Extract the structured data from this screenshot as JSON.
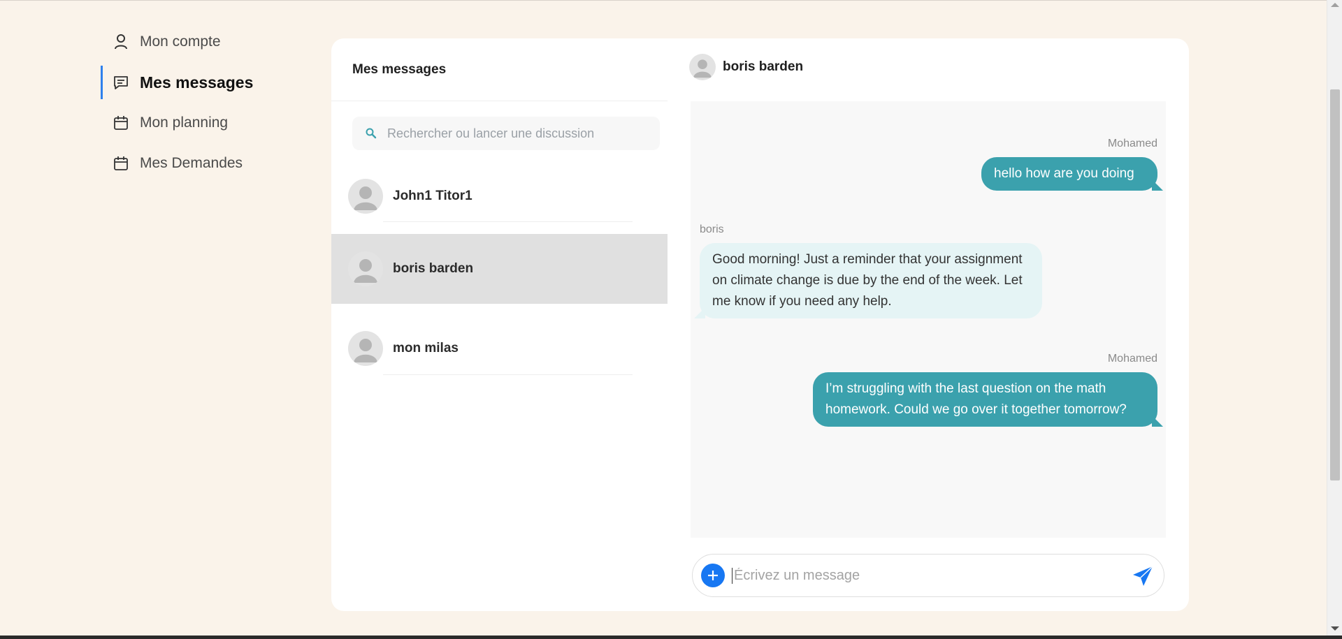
{
  "sidebar": {
    "items": [
      {
        "label": "Mon compte",
        "icon": "user-icon"
      },
      {
        "label": "Mes messages",
        "icon": "message-icon",
        "active": true
      },
      {
        "label": "Mon planning",
        "icon": "calendar-icon"
      },
      {
        "label": "Mes Demandes",
        "icon": "calendar-icon"
      }
    ]
  },
  "conversations": {
    "title": "Mes messages",
    "search_placeholder": "Rechercher ou lancer une discussion",
    "items": [
      {
        "name": "John1 Titor1"
      },
      {
        "name": "boris barden",
        "selected": true
      },
      {
        "name": "mon milas"
      }
    ]
  },
  "chat": {
    "contact_name": "boris barden",
    "messages": [
      {
        "sender": "Mohamed",
        "text": "hello how are you doing",
        "direction": "out"
      },
      {
        "sender": "boris",
        "text": "Good morning! Just a reminder that your assignment on climate change is due by the end of the week. Let me know if you need any help.",
        "direction": "in"
      },
      {
        "sender": "Mohamed",
        "text": "I’m struggling with the last question on the math homework. Could we go over it together tomorrow?",
        "direction": "out"
      }
    ],
    "composer_placeholder": "Écrivez un message"
  },
  "colors": {
    "background": "#faf3ea",
    "outgoing_bubble": "#3ba1ad",
    "incoming_bubble": "#e5f4f5",
    "accent": "#1777f2",
    "selected_conversation": "#e0e0e0"
  }
}
